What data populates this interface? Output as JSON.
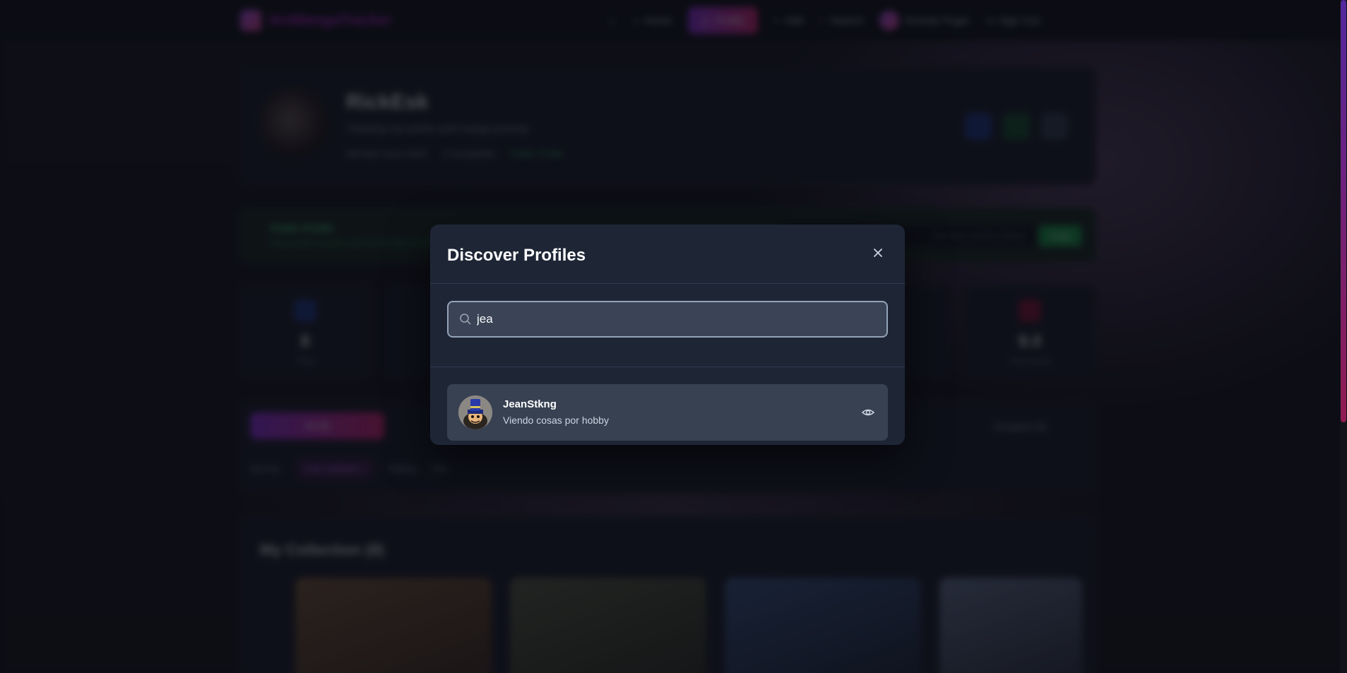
{
  "app": {
    "name": "AniMangaTracker"
  },
  "nav": {
    "home": "Home",
    "profile": "Profile",
    "add": "Add",
    "search": "Search",
    "user": "Vicente Pugei",
    "sign_out": "Sign Out"
  },
  "profile": {
    "name": "RickEsk",
    "bio": "Tracking my anime and manga journey",
    "member_since": "Member since 2024",
    "completed": "2 Completed",
    "public": "Public Profile"
  },
  "public_banner": {
    "title": "Public Profile",
    "text": "Your profile is public and can be discovered by others",
    "url": "...dexr-lean-ukuhim-trifeker",
    "copy": "Copy"
  },
  "stats": [
    {
      "value": "8",
      "label": "Total"
    },
    {
      "value": "9.0",
      "label": "Avg Rating"
    }
  ],
  "filters": {
    "active_tab": "All (8)",
    "dropped_tab": "Dropped (0)",
    "sort_label": "Sort by:",
    "sort_options": [
      "Last Updated ↓",
      "Rating",
      "Title"
    ]
  },
  "collection": {
    "title": "My Collection (8)"
  },
  "modal": {
    "title": "Discover Profiles",
    "search_value": "jea",
    "results": [
      {
        "name": "JeanStkng",
        "bio": "Viendo cosas por hobby"
      }
    ]
  },
  "colors": {
    "accent_start": "#9333ea",
    "accent_end": "#db2777",
    "modal_bg": "#1e2636",
    "result_bg": "#374151"
  }
}
